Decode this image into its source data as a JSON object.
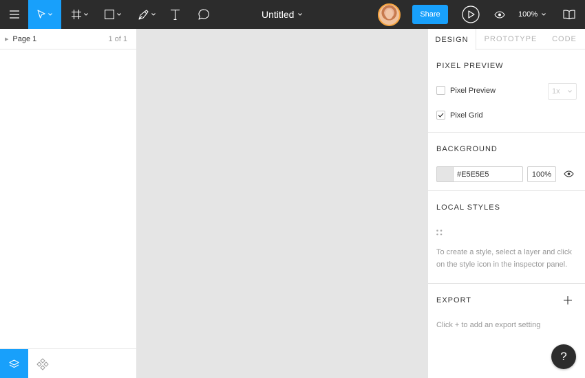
{
  "toolbar": {
    "menu_icon": "hamburger-menu-icon",
    "move_tool_icon": "move-cursor-icon",
    "frame_tool_icon": "frame-icon",
    "shape_tool_icon": "rectangle-icon",
    "pen_tool_icon": "pen-icon",
    "text_tool_icon": "text-icon",
    "comment_tool_icon": "comment-icon",
    "title": "Untitled",
    "share_label": "Share",
    "zoom": "100%",
    "active_tool_color": "#18a0fb",
    "bar_color": "#2c2c2c",
    "avatar_ring_color": "#f7a540"
  },
  "left_panel": {
    "page_name": "Page 1",
    "page_count": "1 of 1",
    "bottom_tabs": [
      "layers-icon",
      "components-icon"
    ]
  },
  "canvas": {
    "background": "#E5E5E5"
  },
  "right_panel": {
    "tabs": [
      "DESIGN",
      "PROTOTYPE",
      "CODE"
    ],
    "active_tab": "DESIGN",
    "pixel_preview": {
      "title": "PIXEL PREVIEW",
      "pixel_preview_label": "Pixel Preview",
      "pixel_preview_checked": false,
      "resolution": "1x",
      "pixel_grid_label": "Pixel Grid",
      "pixel_grid_checked": true
    },
    "background": {
      "title": "BACKGROUND",
      "hex": "#E5E5E5",
      "opacity": "100%"
    },
    "local_styles": {
      "title": "LOCAL STYLES",
      "help": "To create a style, select a layer and click on the style icon in the inspector panel."
    },
    "export": {
      "title": "EXPORT",
      "help": "Click + to add an export setting"
    }
  },
  "help_button": "?"
}
